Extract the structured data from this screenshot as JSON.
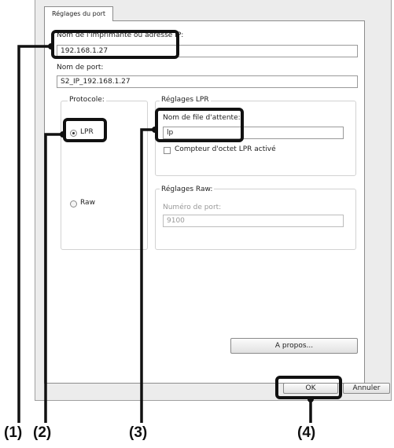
{
  "window": {
    "tab_label": "Réglages du port"
  },
  "printer": {
    "label": "Nom de l'imprimante ou adresse IP:",
    "value": "192.168.1.27"
  },
  "port_name": {
    "label": "Nom de port:",
    "value": "S2_IP_192.168.1.27"
  },
  "protocol": {
    "label": "Protocole:",
    "lpr_label": "LPR",
    "raw_label": "Raw",
    "selected": "LPR"
  },
  "lpr_settings": {
    "label": "Réglages LPR",
    "queue_label": "Nom de file d'attente:",
    "queue_value": "lp",
    "counter_label": "Compteur d'octet LPR activé"
  },
  "raw_settings": {
    "label": "Réglages Raw:",
    "port_label": "Numéro de port:",
    "port_value": "9100"
  },
  "buttons": {
    "about": "A propos...",
    "ok": "OK",
    "cancel": "Annuler"
  },
  "callouts": [
    "(1)",
    "(2)",
    "(3)",
    "(4)"
  ]
}
